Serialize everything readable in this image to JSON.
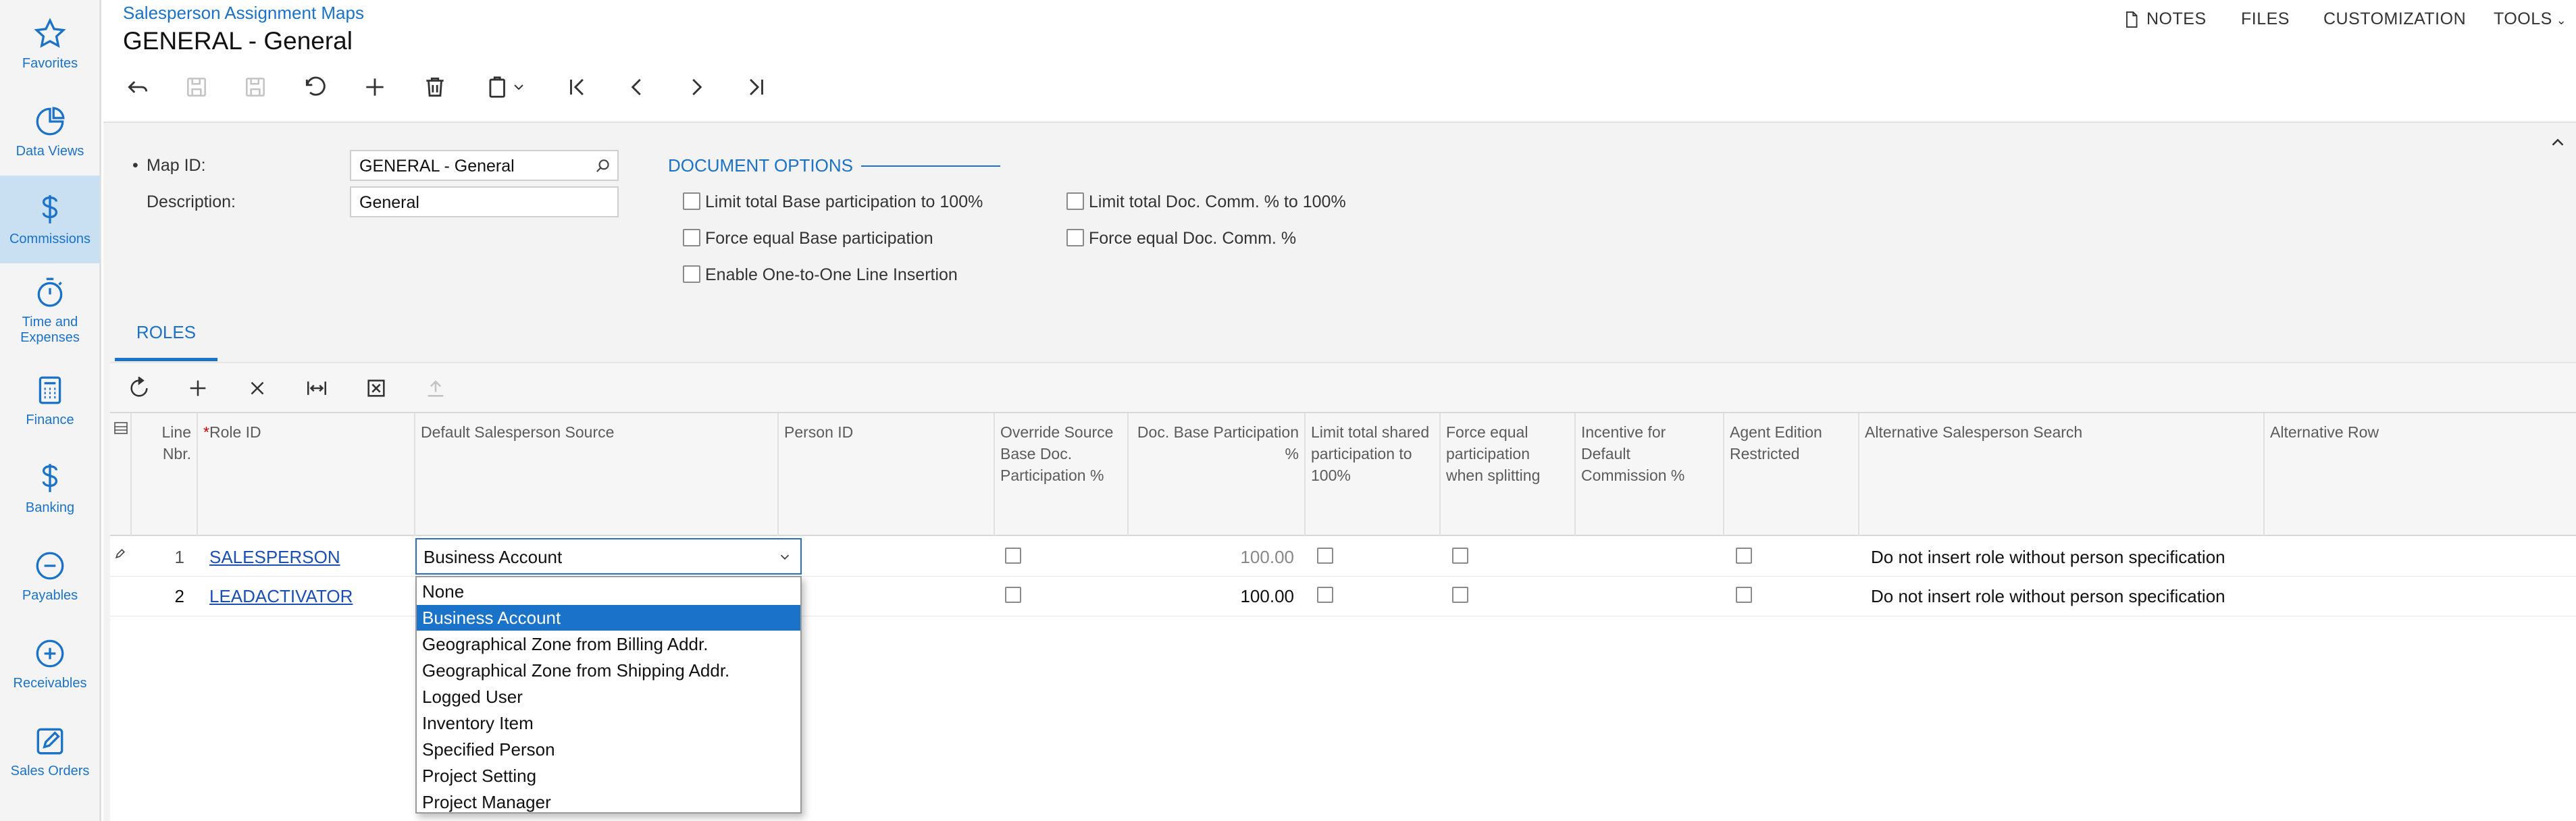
{
  "sidebar": {
    "items": [
      {
        "label": "Favorites",
        "icon": "star-icon"
      },
      {
        "label": "Data Views",
        "icon": "pie-chart-icon"
      },
      {
        "label": "Commissions",
        "icon": "dollar-icon"
      },
      {
        "label": "Time and Expenses",
        "icon": "stopwatch-icon"
      },
      {
        "label": "Finance",
        "icon": "calculator-icon"
      },
      {
        "label": "Banking",
        "icon": "dollar-icon"
      },
      {
        "label": "Payables",
        "icon": "minus-circle-icon"
      },
      {
        "label": "Receivables",
        "icon": "plus-circle-icon"
      },
      {
        "label": "Sales Orders",
        "icon": "edit-icon"
      }
    ]
  },
  "header": {
    "breadcrumb": "Salesperson Assignment Maps",
    "title": "GENERAL - General",
    "links": {
      "notes": "NOTES",
      "files": "FILES",
      "customization": "CUSTOMIZATION",
      "tools": "TOOLS"
    }
  },
  "form": {
    "map_id_label": "Map ID:",
    "map_id_value": "GENERAL - General",
    "description_label": "Description:",
    "description_value": "General",
    "doc_options_title": "DOCUMENT OPTIONS",
    "options": {
      "limit_base": "Limit total Base participation to 100%",
      "force_base": "Force equal Base participation",
      "one_to_one": "Enable One-to-One Line Insertion",
      "limit_comm": "Limit total Doc. Comm. % to 100%",
      "force_comm": "Force equal Doc. Comm. %"
    }
  },
  "tabs": {
    "roles": "ROLES"
  },
  "grid": {
    "columns": {
      "line_nbr": "Line Nbr.",
      "role_id": "Role ID",
      "default_source": "Default Salesperson Source",
      "person_id": "Person ID",
      "override": "Override Source Base Doc. Participation %",
      "doc_base": "Doc. Base Participation %",
      "limit_shared": "Limit total shared participation to 100%",
      "force_equal": "Force equal participation when splitting",
      "incentive": "Incentive for Default Commission %",
      "agent": "Agent Edition Restricted",
      "alt_search": "Alternative Salesperson Search",
      "alt_row": "Alternative Row"
    },
    "rows": [
      {
        "line": "1",
        "role": "SALESPERSON",
        "source": "Business Account",
        "doc_base": "100.00",
        "alt_search": "Do not insert role without person specification"
      },
      {
        "line": "2",
        "role": "LEADACTIVATOR",
        "source": "",
        "doc_base": "100.00",
        "alt_search": "Do not insert role without person specification"
      }
    ]
  },
  "dropdown": {
    "options": [
      "None",
      "Business Account",
      "Geographical Zone from Billing Addr.",
      "Geographical Zone from Shipping Addr.",
      "Logged User",
      "Inventory Item",
      "Specified Person",
      "Project Setting",
      "Project Manager"
    ],
    "selected": "Business Account"
  },
  "colors": {
    "accent": "#1a72c9",
    "sidebar_active": "#c9e0f2",
    "link": "#1a4fb8"
  }
}
